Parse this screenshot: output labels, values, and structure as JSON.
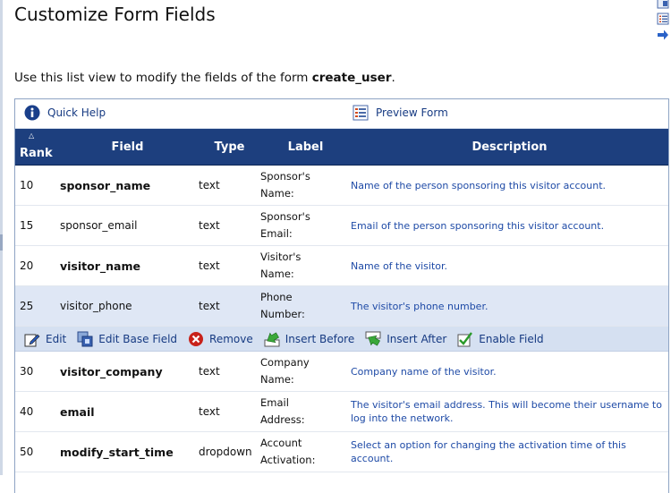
{
  "page": {
    "title": "Customize Form Fields",
    "intro_prefix": "Use this list view to modify the fields of the form ",
    "form_name": "create_user",
    "intro_suffix": "."
  },
  "toolbar": {
    "quick_help": "Quick Help",
    "preview_form": "Preview Form"
  },
  "table": {
    "headers": {
      "rank": "Rank",
      "field": "Field",
      "type": "Type",
      "label": "Label",
      "description": "Description"
    },
    "rows": [
      {
        "rank": "10",
        "field": "sponsor_name",
        "type": "text",
        "label1": "Sponsor's",
        "label2": "Name:",
        "description": "Name of the person sponsoring this visitor account."
      },
      {
        "rank": "15",
        "field": "sponsor_email",
        "type": "text",
        "label1": "Sponsor's",
        "label2": "Email:",
        "description": "Email of the person sponsoring this visitor account."
      },
      {
        "rank": "20",
        "field": "visitor_name",
        "type": "text",
        "label1": "Visitor's",
        "label2": "Name:",
        "description": "Name of the visitor."
      },
      {
        "rank": "25",
        "field": "visitor_phone",
        "type": "text",
        "label1": "Phone",
        "label2": "Number:",
        "description": "The visitor's phone number."
      },
      {
        "rank": "30",
        "field": "visitor_company",
        "type": "text",
        "label1": "Company",
        "label2": "Name:",
        "description": "Company name of the visitor."
      },
      {
        "rank": "40",
        "field": "email",
        "type": "text",
        "label1": "Email",
        "label2": "Address:",
        "description": "The visitor's email address. This will become their username to log into the network."
      },
      {
        "rank": "50",
        "field": "modify_start_time",
        "type": "dropdown",
        "label1": "Account",
        "label2": "Activation:",
        "description": "Select an option for changing the activation time of this account."
      }
    ]
  },
  "actions": {
    "edit": "Edit",
    "edit_base_field": "Edit Base Field",
    "remove": "Remove",
    "insert_before": "Insert Before",
    "insert_after": "Insert After",
    "enable_field": "Enable Field"
  },
  "colors": {
    "header_bg": "#1d3f7e",
    "link": "#1e4aa6",
    "selected_row": "#dfe7f5",
    "action_bar": "#d5e0f1"
  }
}
